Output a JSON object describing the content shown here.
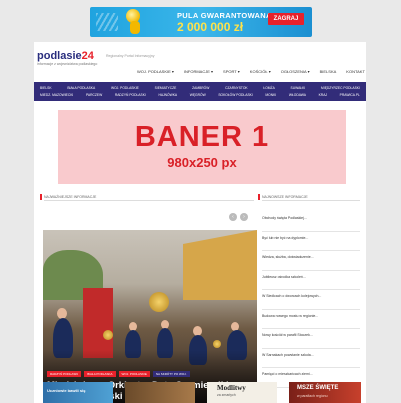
{
  "top_ad": {
    "headline": "PULA GWARANTOWANA",
    "amount": "2 000 000 zł",
    "button_label": "ZAGRAJ"
  },
  "header": {
    "logo_text": "podlasie",
    "logo_number": "24",
    "logo_subtitle": "informacje z województwa podlaskiego",
    "tagline": "Regionalny Portal Informacyjny",
    "nav": [
      "WOJ. PODLASKIE ▾",
      "INFORMACJE ▾",
      "SPORT ▾",
      "KOŚCIÓŁ ▾",
      "OGŁOSZENIA ▾",
      "BIELSKA",
      "KONTAKT"
    ]
  },
  "menu": {
    "row1": [
      "BIELSK",
      "BIAŁA PODLASKA",
      "WOJ. PODLASKIE",
      "SIEMIATYCZE",
      "ZAMBRÓW",
      "CZARNYSTOK",
      "ŁOMŻA",
      "SUWAŁKI",
      "MIĘDZYRZEC PODLASKI"
    ],
    "row2": [
      "MIEDZ. MAZOWIECKI",
      "PARCZEW",
      "RADZYŃ PODLASKI",
      "HAJNÓWKA",
      "WĘGRÓW",
      "SOKOŁÓW PODLASKI",
      "MONKI",
      "WŁODAWA",
      "KRAJ",
      "PRAWICA.PL"
    ]
  },
  "banner": {
    "line1": "BANER 1",
    "line2": "980x250 px"
  },
  "sections": {
    "left_heading": "NAJWAŻNIEJSZE INFORMACJE",
    "right_heading": "NAJNOWSZE INFORMACJE"
  },
  "carousel": {
    "prev": "‹",
    "next": "›"
  },
  "featured": {
    "tags": [
      "RADZYŃ PODLASKI",
      "BIAŁA PODLASKA",
      "WOJ. PODLASKIE",
      "NA SKRÓTY PO WOJ."
    ],
    "title": "Młodzieżowa Orkiestra Dęta Czemierniki - Radzyń Podlaski /REPORTAŻ/"
  },
  "sidebar": {
    "items": [
      "Obchody święta Podlaskiej...",
      "Być lub nie być na dyplomie...",
      "Wiedza, służba, doświadczenie...",
      "Jubileusz ośrodka szkoleń...",
      "W Siedlcach o dworcach kolejowych...",
      "Budowa nowego mostu w regionie...",
      "Nowy kościół w parafii Stoczek...",
      "W Sarnakach powstanie szkoła...",
      "Pamięci o mieszkańcach ziemi..."
    ]
  },
  "thumbs": {
    "t1": "Uczniowie bawili się",
    "t3_title": "Modlitwy",
    "t3_sub": "za zmarłych",
    "t4_title": "MSZE ŚWIĘTE",
    "t4_sub": "w parafiach regionu"
  }
}
